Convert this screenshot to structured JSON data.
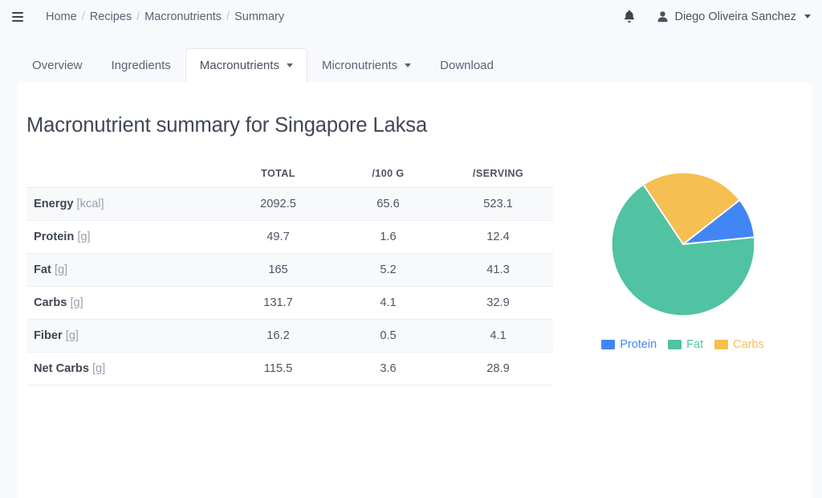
{
  "header": {
    "menu_icon": "hamburger-icon",
    "breadcrumb": [
      "Home",
      "Recipes",
      "Macronutrients",
      "Summary"
    ],
    "breadcrumb_separator": "/",
    "notifications_icon": "bell-icon",
    "user_icon": "user-icon",
    "user_name": "Diego Oliveira Sanchez",
    "user_caret": "caret-down-icon"
  },
  "tabs": [
    {
      "label": "Overview",
      "active": false,
      "has_caret": false
    },
    {
      "label": "Ingredients",
      "active": false,
      "has_caret": false
    },
    {
      "label": "Macronutrients",
      "active": true,
      "has_caret": true
    },
    {
      "label": "Micronutrients",
      "active": false,
      "has_caret": true
    },
    {
      "label": "Download",
      "active": false,
      "has_caret": false
    }
  ],
  "main": {
    "title": "Macronutrient summary for Singapore Laksa",
    "table": {
      "columns": [
        "",
        "TOTAL",
        "/100 G",
        "/SERVING"
      ],
      "rows": [
        {
          "name": "Energy",
          "unit": "[kcal]",
          "total": "2092.5",
          "per100g": "65.6",
          "perserving": "523.1"
        },
        {
          "name": "Protein",
          "unit": "[g]",
          "total": "49.7",
          "per100g": "1.6",
          "perserving": "12.4"
        },
        {
          "name": "Fat",
          "unit": "[g]",
          "total": "165",
          "per100g": "5.2",
          "perserving": "41.3"
        },
        {
          "name": "Carbs",
          "unit": "[g]",
          "total": "131.7",
          "per100g": "4.1",
          "perserving": "32.9"
        },
        {
          "name": "Fiber",
          "unit": "[g]",
          "total": "16.2",
          "per100g": "0.5",
          "perserving": "4.1"
        },
        {
          "name": "Net Carbs",
          "unit": "[g]",
          "total": "115.5",
          "per100g": "3.6",
          "perserving": "28.9"
        }
      ]
    }
  },
  "chart_data": {
    "type": "pie",
    "title": "",
    "labels": [
      "Protein",
      "Fat",
      "Carbs"
    ],
    "values": [
      9.0,
      67.2,
      23.8
    ],
    "colors": [
      "#4286f5",
      "#51c2a2",
      "#f5bf51"
    ],
    "legend_position": "bottom",
    "start_angle_deg": 52,
    "direction": "clockwise",
    "slice_border": "#ffffff"
  },
  "theme": {
    "background": "#f8f9fc",
    "card": "#ffffff",
    "text": "#4a5161",
    "muted": "#9aa1b0",
    "stripe": "#f8f9fa",
    "border": "#e6e8ee"
  }
}
